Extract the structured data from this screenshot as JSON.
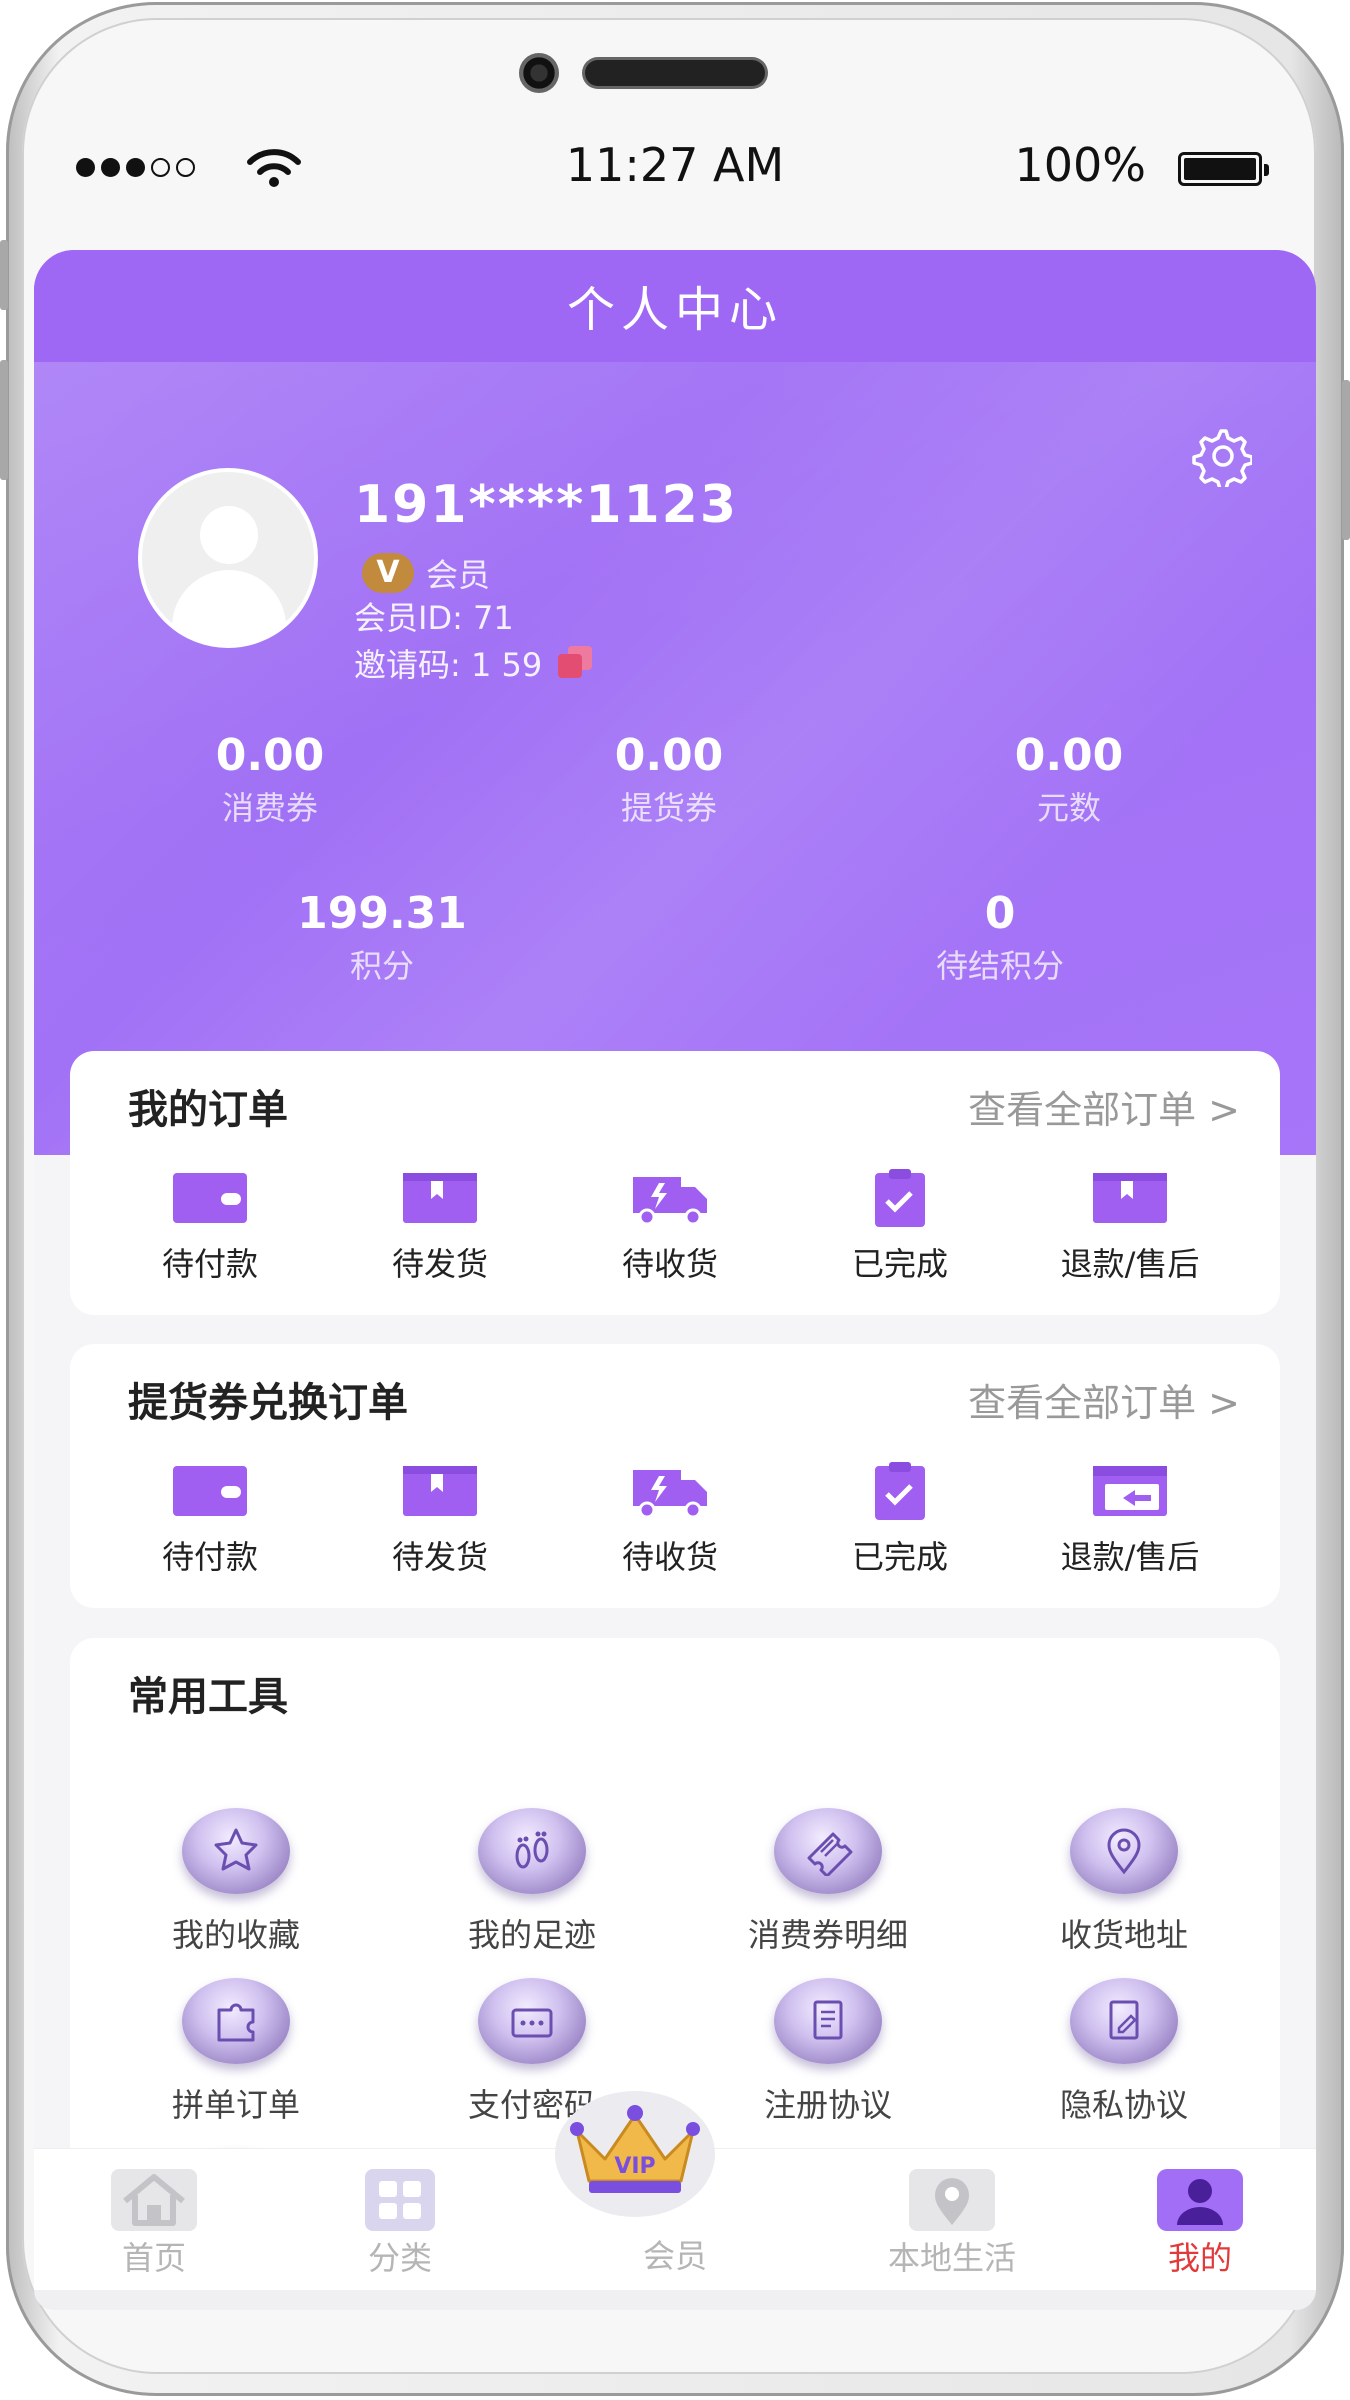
{
  "status_bar": {
    "time": "11:27 AM",
    "battery": "100%"
  },
  "header": {
    "title": "个人中心"
  },
  "profile": {
    "phone": "191****1123",
    "badge": "V",
    "member_label": "会员",
    "member_id": "会员ID: 71",
    "invite_code": "邀请码: 1 59"
  },
  "stats": [
    {
      "value": "0.00",
      "label": "消费券"
    },
    {
      "value": "0.00",
      "label": "提货券"
    },
    {
      "value": "0.00",
      "label": "元数"
    },
    {
      "value": "199.31",
      "label": "积分"
    },
    {
      "value": "0",
      "label": "待结积分"
    }
  ],
  "orders": {
    "title": "我的订单",
    "link": "查看全部订单 >",
    "items": [
      "待付款",
      "待发货",
      "待收货",
      "已完成",
      "退款/售后"
    ]
  },
  "voucher_orders": {
    "title": "提货券兑换订单",
    "link": "查看全部订单 >",
    "items": [
      "待付款",
      "待发货",
      "待收货",
      "已完成",
      "退款/售后"
    ]
  },
  "tools": {
    "title": "常用工具",
    "items": [
      "我的收藏",
      "我的足迹",
      "消费券明细",
      "收货地址",
      "拼单订单",
      "支付密码",
      "注册协议",
      "隐私协议"
    ]
  },
  "tabbar": {
    "items": [
      "首页",
      "分类",
      "会员",
      "本地生活",
      "我的"
    ],
    "vip_text": "VIP",
    "active_color": "#e23a3a"
  },
  "colors": {
    "accent": "#a26ef6",
    "icon": "#a05ff0"
  }
}
